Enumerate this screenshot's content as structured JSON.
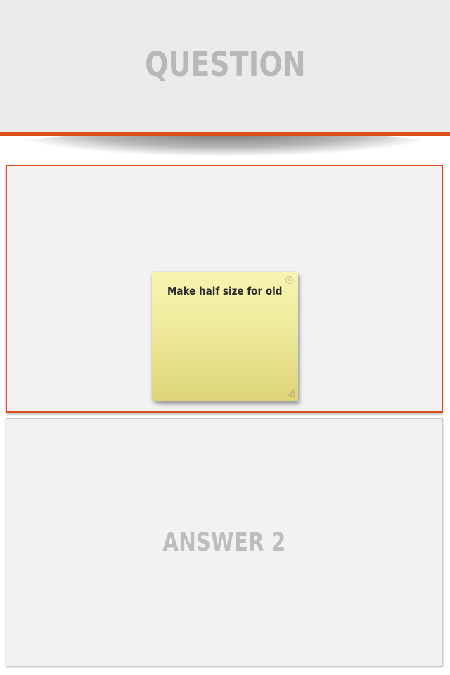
{
  "header": {
    "title": "QUESTION"
  },
  "answers": [
    {
      "sticky_note": {
        "text": "Make half size for old",
        "close_icon": "close-icon",
        "resize_icon": "resize-grip-icon"
      }
    },
    {
      "label": "ANSWER 2"
    }
  ],
  "colors": {
    "accent": "#e0501c",
    "header_background": "#ebebeb",
    "card_background": "#f2f2f2",
    "placeholder_text": "#bdbdbd",
    "sticky_note": "#eeea9a"
  }
}
